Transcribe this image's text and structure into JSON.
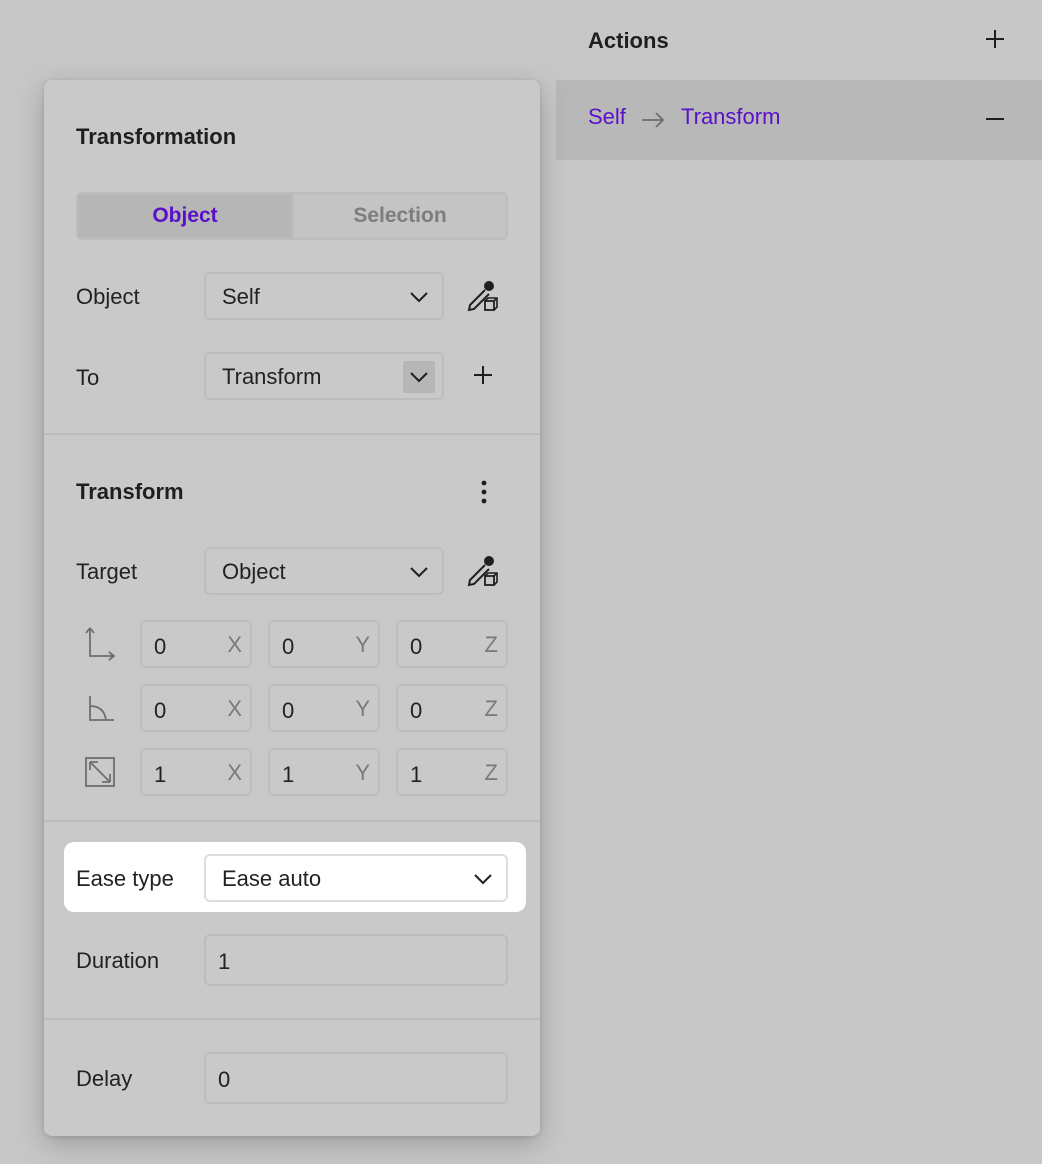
{
  "actions": {
    "title": "Actions",
    "add_icon": "plus-icon",
    "items": [
      {
        "source": "Self",
        "target": "Transform",
        "remove_icon": "minus-icon"
      }
    ]
  },
  "transformation": {
    "title": "Transformation",
    "mode_tabs": [
      {
        "label": "Object",
        "active": true
      },
      {
        "label": "Selection",
        "active": false
      }
    ],
    "object_label": "Object",
    "object_value": "Self",
    "to_label": "To",
    "to_value": "Transform"
  },
  "transform": {
    "title": "Transform",
    "target_label": "Target",
    "target_value": "Object",
    "rows": [
      {
        "icon": "position-icon",
        "x": "0",
        "y": "0",
        "z": "0"
      },
      {
        "icon": "rotation-icon",
        "x": "0",
        "y": "0",
        "z": "0"
      },
      {
        "icon": "scale-icon",
        "x": "1",
        "y": "1",
        "z": "1"
      }
    ],
    "axis_labels": {
      "x": "X",
      "y": "Y",
      "z": "Z"
    }
  },
  "easing": {
    "ease_type_label": "Ease type",
    "ease_type_value": "Ease auto",
    "duration_label": "Duration",
    "duration_value": "1"
  },
  "delay": {
    "label": "Delay",
    "value": "0"
  },
  "colors": {
    "accent": "#5a10c8",
    "background": "#c7c7c7",
    "highlight": "#ffffff"
  }
}
